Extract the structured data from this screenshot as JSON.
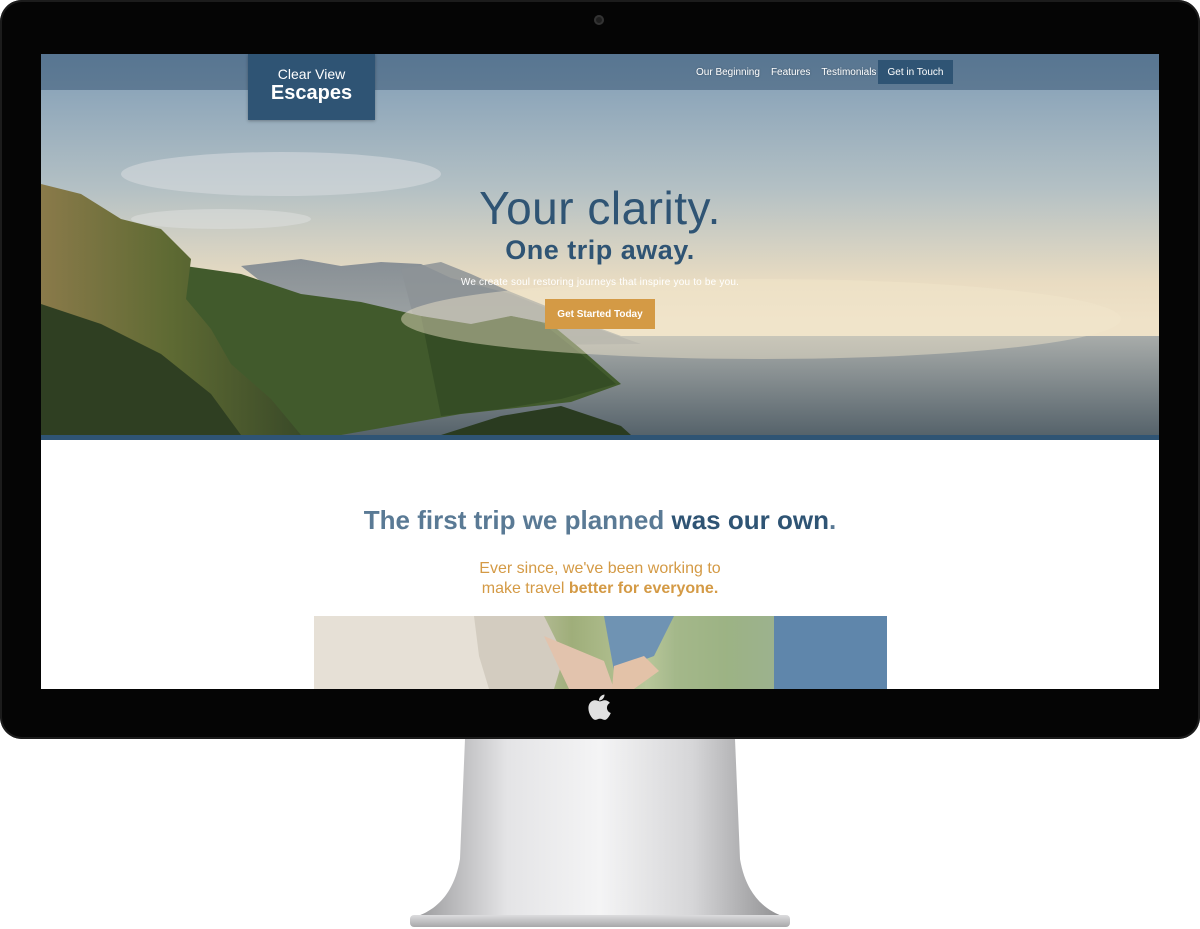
{
  "nav": {
    "logo_line1": "Clear View",
    "logo_line2": "Escapes",
    "links": [
      "Our Beginning",
      "Features",
      "Testimonials"
    ],
    "cta_label": "Get in Touch"
  },
  "hero": {
    "title": "Your clarity.",
    "subtitle": "One trip away.",
    "tagline": "We create soul restoring journeys that inspire you to be you.",
    "cta_label": "Get Started Today"
  },
  "story": {
    "heading_regular": "The first trip we planned ",
    "heading_bold": "was our own",
    "heading_period": ".",
    "sub_line1": "Ever since, we've been working to",
    "sub_line2_regular": "make travel ",
    "sub_line2_bold": "better for everyone."
  },
  "colors": {
    "brand_blue": "#2f5474",
    "accent_gold": "#d49a45",
    "heading_light_blue": "#5a7a95"
  },
  "icons": {
    "device_logo": "apple-logo-icon",
    "camera": "webcam-icon"
  }
}
